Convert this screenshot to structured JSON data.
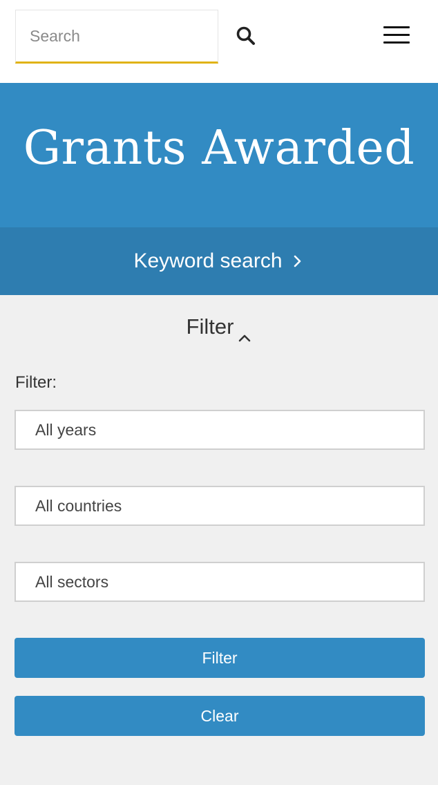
{
  "header": {
    "search_placeholder": "Search",
    "search_icon": "search-icon",
    "menu_icon": "hamburger-menu-icon",
    "accent_color": "#e0b313"
  },
  "hero": {
    "title": "Grants Awarded",
    "background": "#328bc3"
  },
  "keyword": {
    "label": "Keyword search",
    "icon": "chevron-right-icon"
  },
  "filter_panel": {
    "toggle_label": "Filter",
    "toggle_icon": "chevron-up-icon",
    "section_label": "Filter:",
    "selects": {
      "years": "All years",
      "countries": "All countries",
      "sectors": "All sectors"
    },
    "filter_button": "Filter",
    "clear_button": "Clear",
    "button_color": "#328bc3"
  }
}
